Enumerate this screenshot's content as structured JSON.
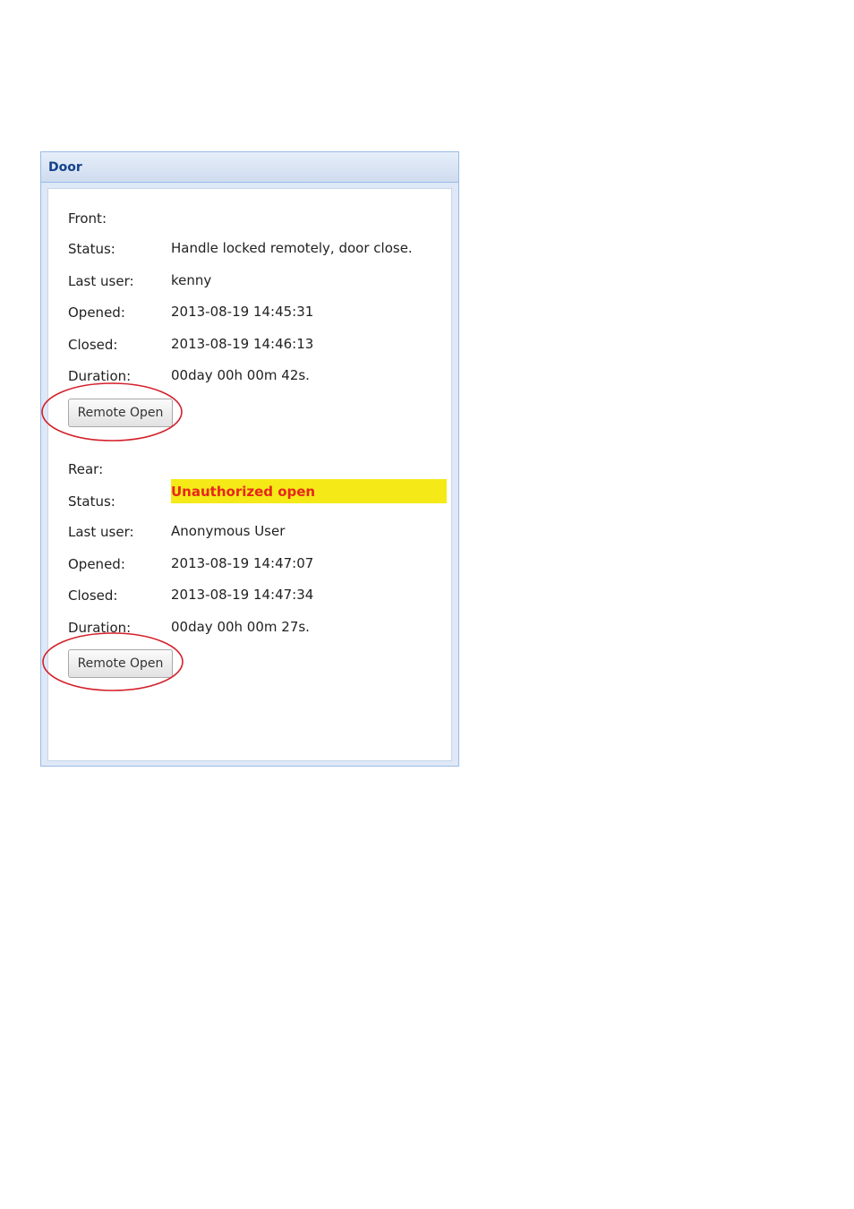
{
  "panel": {
    "title": "Door"
  },
  "doors": [
    {
      "name": "Front:",
      "fields": {
        "status_label": "Status:",
        "status_value": "Handle locked remotely, door close.",
        "last_user_label": "Last user:",
        "last_user_value": "kenny",
        "opened_label": "Opened:",
        "opened_value": "2013-08-19 14:45:31",
        "closed_label": "Closed:",
        "closed_value": "2013-08-19 14:46:13",
        "duration_label": "Duration:",
        "duration_value": "00day 00h 00m 42s."
      },
      "button_label": "Remote Open"
    },
    {
      "name": "Rear:",
      "fields": {
        "status_label": "Status:",
        "status_value": "Unauthorized open",
        "last_user_label": "Last user:",
        "last_user_value": "Anonymous User",
        "opened_label": "Opened:",
        "opened_value": "2013-08-19 14:47:07",
        "closed_label": "Closed:",
        "closed_value": "2013-08-19 14:47:34",
        "duration_label": "Duration:",
        "duration_value": "00day 00h 00m 27s."
      },
      "button_label": "Remote Open"
    }
  ],
  "colors": {
    "header_title": "#15428b",
    "alert_highlight": "#f5ea17",
    "alert_text": "#e8261d",
    "annotation_circle": "#d41f2a"
  }
}
